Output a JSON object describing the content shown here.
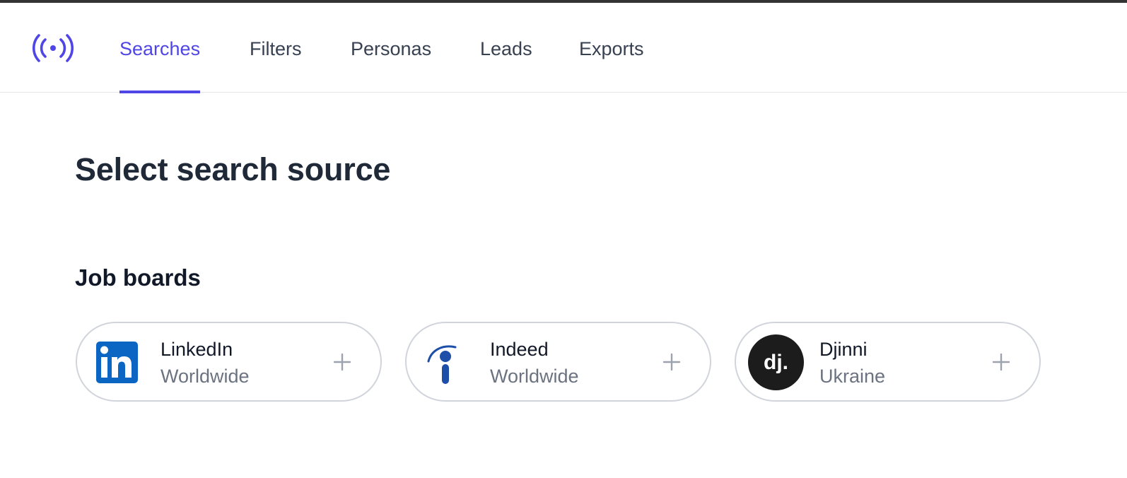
{
  "nav": {
    "logo_icon": "broadcast-icon",
    "tabs": [
      {
        "label": "Searches",
        "active": true
      },
      {
        "label": "Filters",
        "active": false
      },
      {
        "label": "Personas",
        "active": false
      },
      {
        "label": "Leads",
        "active": false
      },
      {
        "label": "Exports",
        "active": false
      }
    ]
  },
  "main": {
    "title": "Select search source",
    "section_title": "Job boards",
    "sources": [
      {
        "name": "LinkedIn",
        "region": "Worldwide",
        "logo": "linkedin-logo",
        "action_icon": "plus-icon"
      },
      {
        "name": "Indeed",
        "region": "Worldwide",
        "logo": "indeed-logo",
        "action_icon": "plus-icon"
      },
      {
        "name": "Djinni",
        "region": "Ukraine",
        "logo": "djinni-logo",
        "logo_text": "dj.",
        "action_icon": "plus-icon"
      }
    ]
  },
  "colors": {
    "accent": "#4f46e5",
    "text_primary": "#1f2937",
    "text_secondary": "#6b7280",
    "border": "#d1d5db",
    "linkedin": "#0a66c2",
    "indeed": "#1d4ea8",
    "djinni": "#1c1c1c"
  }
}
